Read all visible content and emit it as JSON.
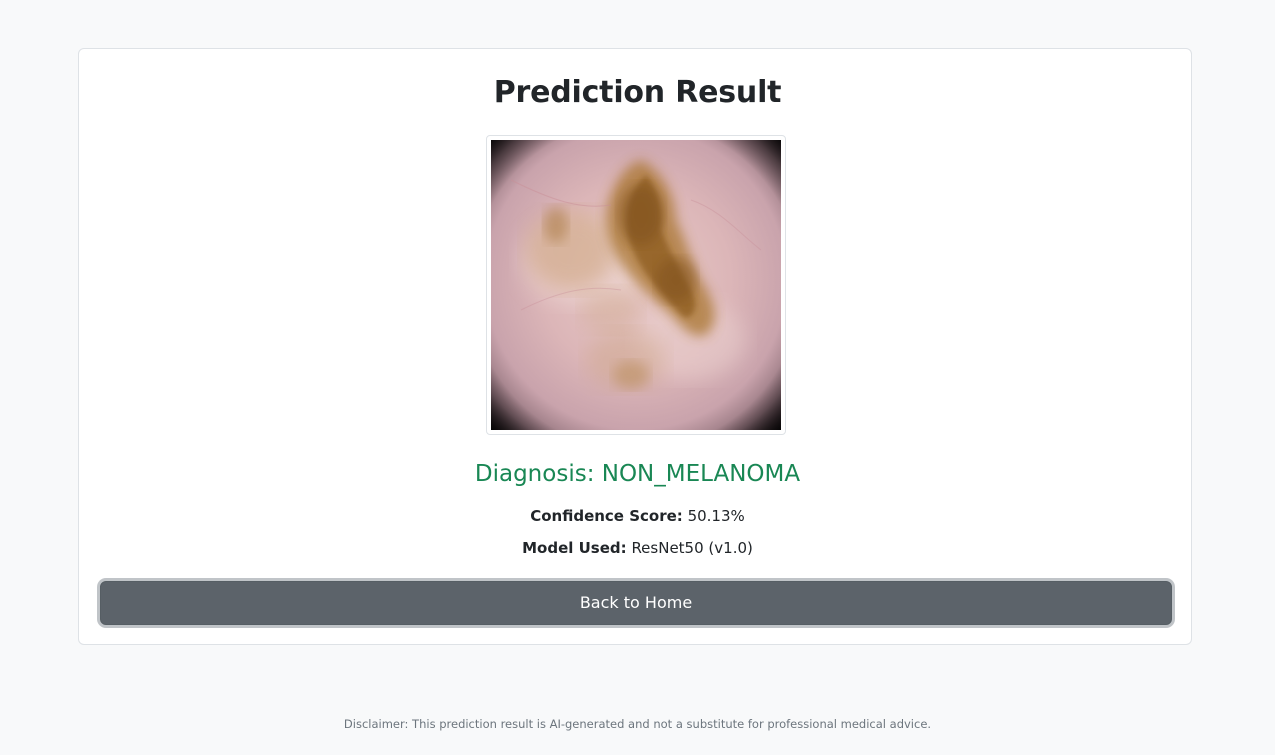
{
  "result": {
    "title": "Prediction Result",
    "image_alt": "lesion-image",
    "diagnosis_text": "Diagnosis: NON_MELANOMA",
    "confidence_label": "Confidence Score:",
    "confidence_value": "50.13%",
    "model_label": "Model Used:",
    "model_value": "ResNet50 (v1.0)",
    "back_button_label": "Back to Home",
    "diagnosis_color": "#198754",
    "button_color": "#5c636a"
  },
  "footer": {
    "disclaimer": "Disclaimer: This prediction result is AI-generated and not a substitute for professional medical advice."
  }
}
